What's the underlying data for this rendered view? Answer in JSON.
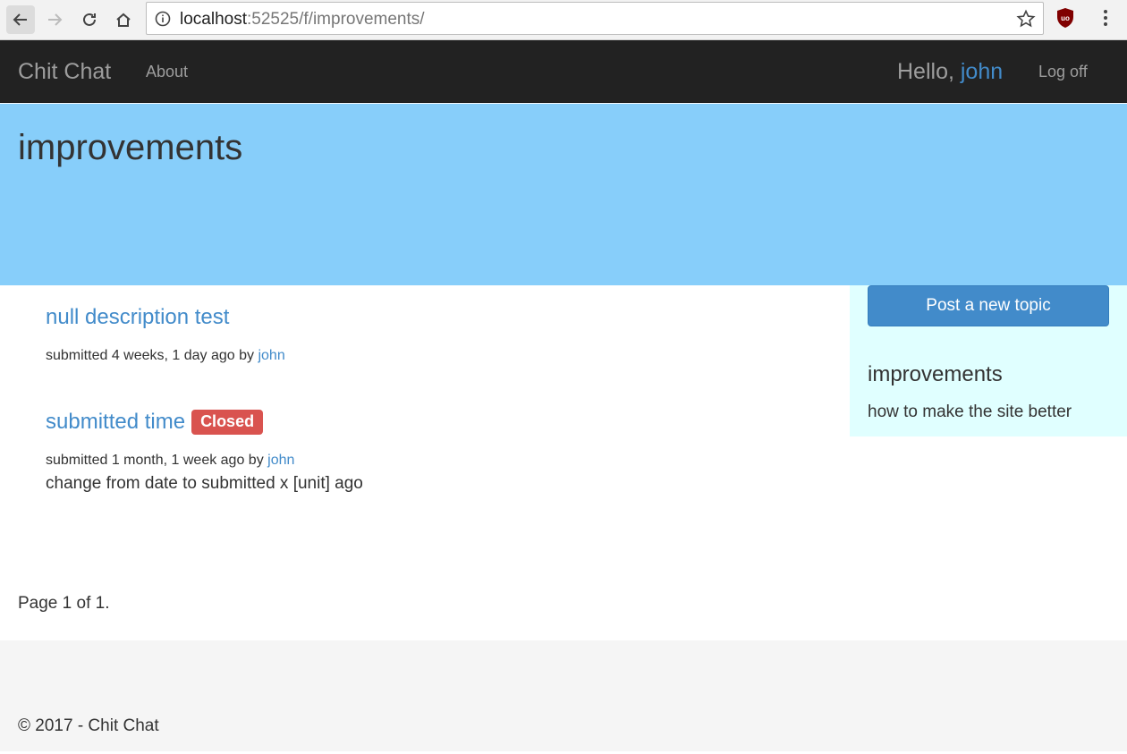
{
  "browser": {
    "url_host": "localhost",
    "url_rest": ":52525/f/improvements/"
  },
  "navbar": {
    "brand": "Chit Chat",
    "about": "About",
    "hello_prefix": "Hello, ",
    "username": "john",
    "logoff": "Log off"
  },
  "forum": {
    "title": "improvements"
  },
  "topics": [
    {
      "title": "null description test",
      "submitted": "submitted 4 weeks, 1 day ago by ",
      "author": "john"
    },
    {
      "title": "submitted time",
      "badge": "Closed",
      "submitted": "submitted 1 month, 1 week ago by ",
      "author": "john",
      "description": "change from date to submitted x [unit] ago"
    }
  ],
  "pager": "Page 1 of 1.",
  "sidebar": {
    "post_button": "Post a new topic",
    "title": "improvements",
    "description": "how to make the site better"
  },
  "footer": "© 2017 - Chit Chat",
  "colors": {
    "jumbotron": "#87cefa",
    "sidebar": "#e0ffff",
    "navbar": "#222222",
    "link": "#428bca",
    "badge_closed": "#d9534f"
  }
}
